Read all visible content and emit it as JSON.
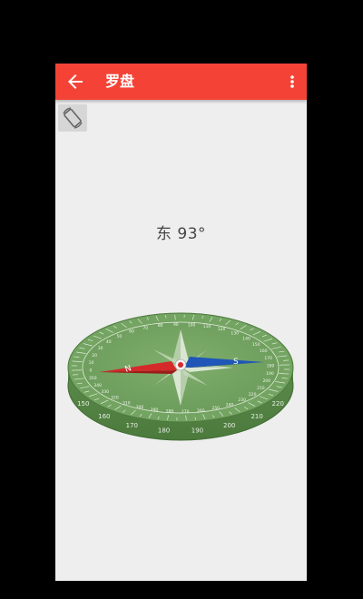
{
  "app_bar": {
    "title": "罗盘",
    "color": "#f44336"
  },
  "icons": {
    "back": "arrow-back-icon",
    "more": "more-vert-icon",
    "rotate": "screen-rotation-icon"
  },
  "compass": {
    "direction": "东",
    "degrees": "93°",
    "heading_text": "东 93°",
    "heading_value": 93,
    "scale_labels": [
      "0",
      "10",
      "20",
      "30",
      "40",
      "50",
      "60",
      "70",
      "80",
      "90",
      "100",
      "110",
      "120",
      "130",
      "140",
      "150",
      "160",
      "170",
      "180",
      "190",
      "200",
      "210",
      "220",
      "230",
      "240",
      "250",
      "260",
      "270",
      "280",
      "290",
      "300",
      "310",
      "320",
      "330",
      "340",
      "350"
    ],
    "rim_labels": [
      "150",
      "160",
      "170",
      "180",
      "190",
      "200",
      "210",
      "220"
    ],
    "needle_north_label": "N",
    "needle_south_label": "S",
    "dial_color": "#6b9b5a",
    "needle_north_color": "#d42a2a",
    "needle_south_color": "#1f56b8"
  }
}
